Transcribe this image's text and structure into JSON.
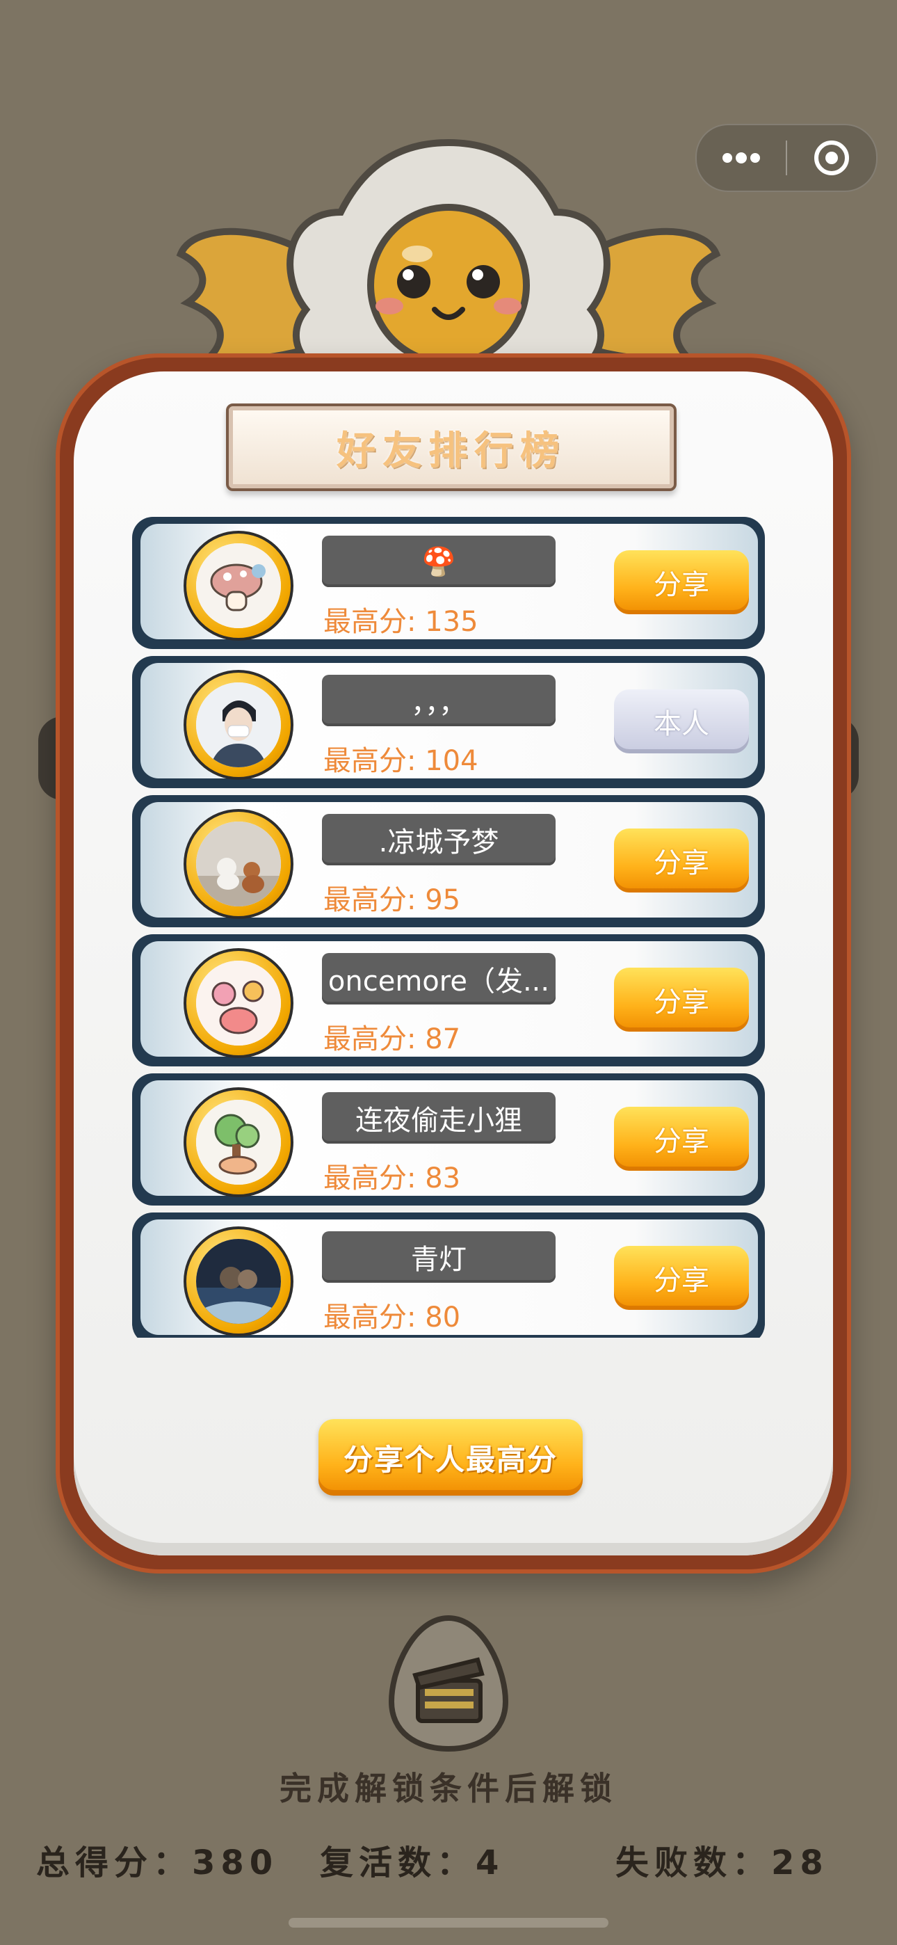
{
  "board": {
    "title": "好友排行榜",
    "share_best_label": "分享个人最高分"
  },
  "leaderboard": [
    {
      "name": "🍄",
      "score_label": "最高分: 135",
      "action_label": "分享",
      "action_type": "share",
      "avatar_icon": "mushroom-avatar-icon"
    },
    {
      "name": "，，，",
      "score_label": "最高分: 104",
      "action_label": "本人",
      "action_type": "self",
      "avatar_icon": "boy-avatar-icon"
    },
    {
      "name": ".凉城予梦",
      "score_label": "最高分: 95",
      "action_label": "分享",
      "action_type": "share",
      "avatar_icon": "dog-photo-avatar-icon"
    },
    {
      "name": "oncemore（发...",
      "score_label": "最高分: 87",
      "action_label": "分享",
      "action_type": "share",
      "avatar_icon": "flower-avatar-icon"
    },
    {
      "name": "连夜偷走小狸",
      "score_label": "最高分: 83",
      "action_label": "分享",
      "action_type": "share",
      "avatar_icon": "tree-avatar-icon"
    },
    {
      "name": "青灯",
      "score_label": "最高分: 80",
      "action_label": "分享",
      "action_type": "share",
      "avatar_icon": "photo-avatar-icon"
    }
  ],
  "locked": {
    "icon": "clapperboard-egg-icon",
    "text": "完成解锁条件后解锁"
  },
  "stats": {
    "total_score": "总得分：380",
    "revives": "复活数：4",
    "fails": "失败数：28"
  },
  "colors": {
    "background": "#7d7463",
    "share_button": "#ffb21a",
    "self_button": "#c8cbe0",
    "score_text": "#ee8a3a",
    "name_box": "#5f5f5f"
  }
}
